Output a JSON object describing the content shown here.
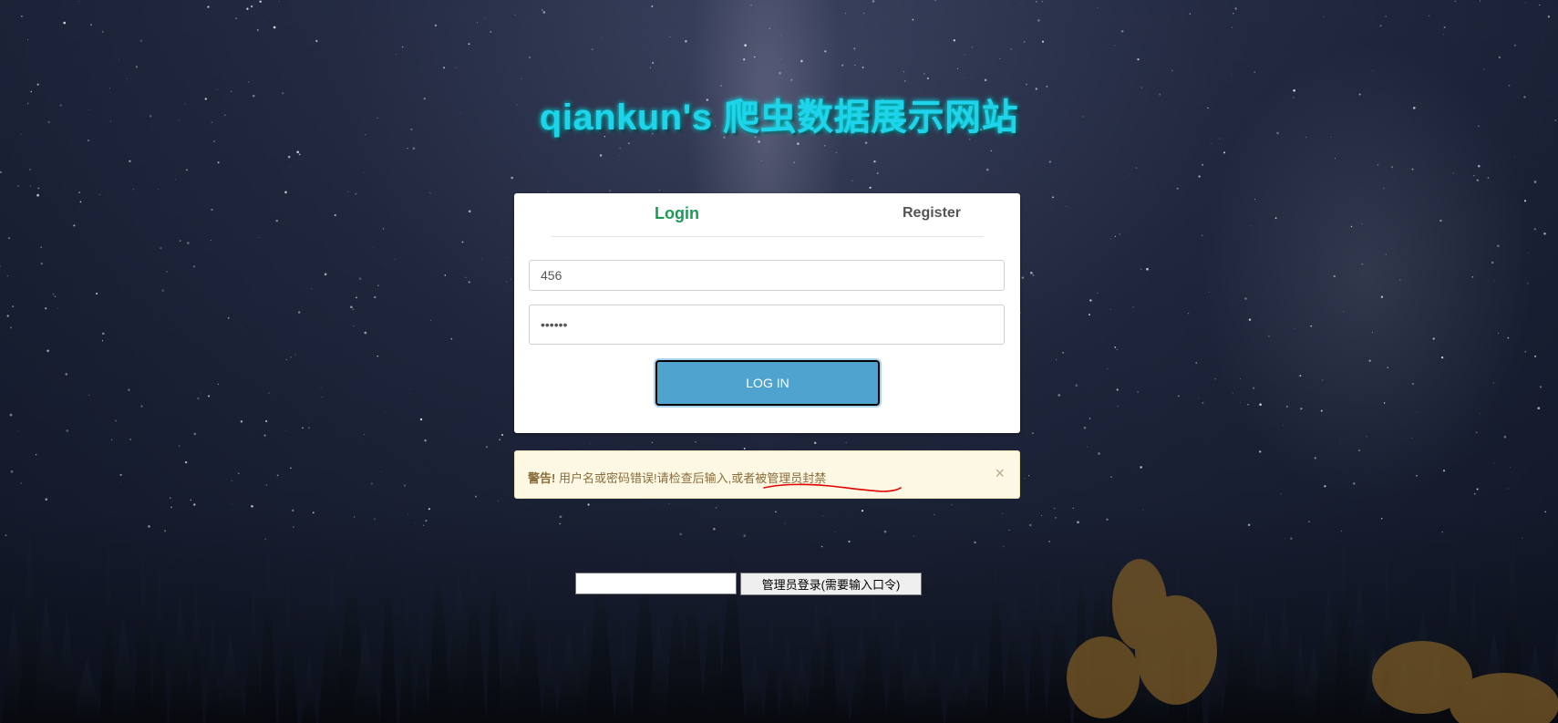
{
  "page": {
    "title": "qiankun's 爬虫数据展示网站"
  },
  "tabs": {
    "login_label": "Login",
    "register_label": "Register"
  },
  "form": {
    "username_value": "456",
    "password_value": "••••••",
    "submit_label": "LOG IN"
  },
  "alert": {
    "prefix": "警告!",
    "message": "用户名或密码错误!请检查后输入,或者被管理员封禁",
    "close_symbol": "×"
  },
  "admin": {
    "input_value": "",
    "button_label": "管理员登录(需要输入口令)"
  },
  "colors": {
    "title": "#1fd4ea",
    "active_tab": "#1a9a55",
    "login_button": "#4fa3cf",
    "alert_background": "#fcf8e3",
    "alert_text": "#8a6d3b",
    "annotation": "#e00000"
  }
}
